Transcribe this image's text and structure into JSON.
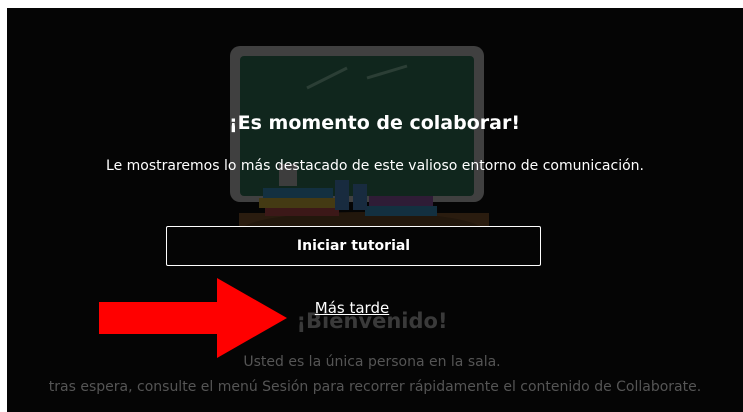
{
  "onboarding": {
    "title": "¡Es momento de colaborar!",
    "description": "Le mostraremos lo más destacado de este valioso entorno de comunicación.",
    "start_tutorial_label": "Iniciar tutorial",
    "later_label": "Más tarde"
  },
  "background": {
    "welcome_title": "¡Bienvenido!",
    "line1": "Usted es la única persona en la sala.",
    "line2": "tras espera, consulte el menú Sesión para recorrer rápidamente el contenido de Collaborate."
  },
  "icons": {
    "illustration": "classroom-chalkboard-illustration",
    "annotation": "red-arrow-icon"
  },
  "colors": {
    "backdrop": "#050505",
    "text": "#ffffff",
    "arrow": "#ff0000"
  }
}
